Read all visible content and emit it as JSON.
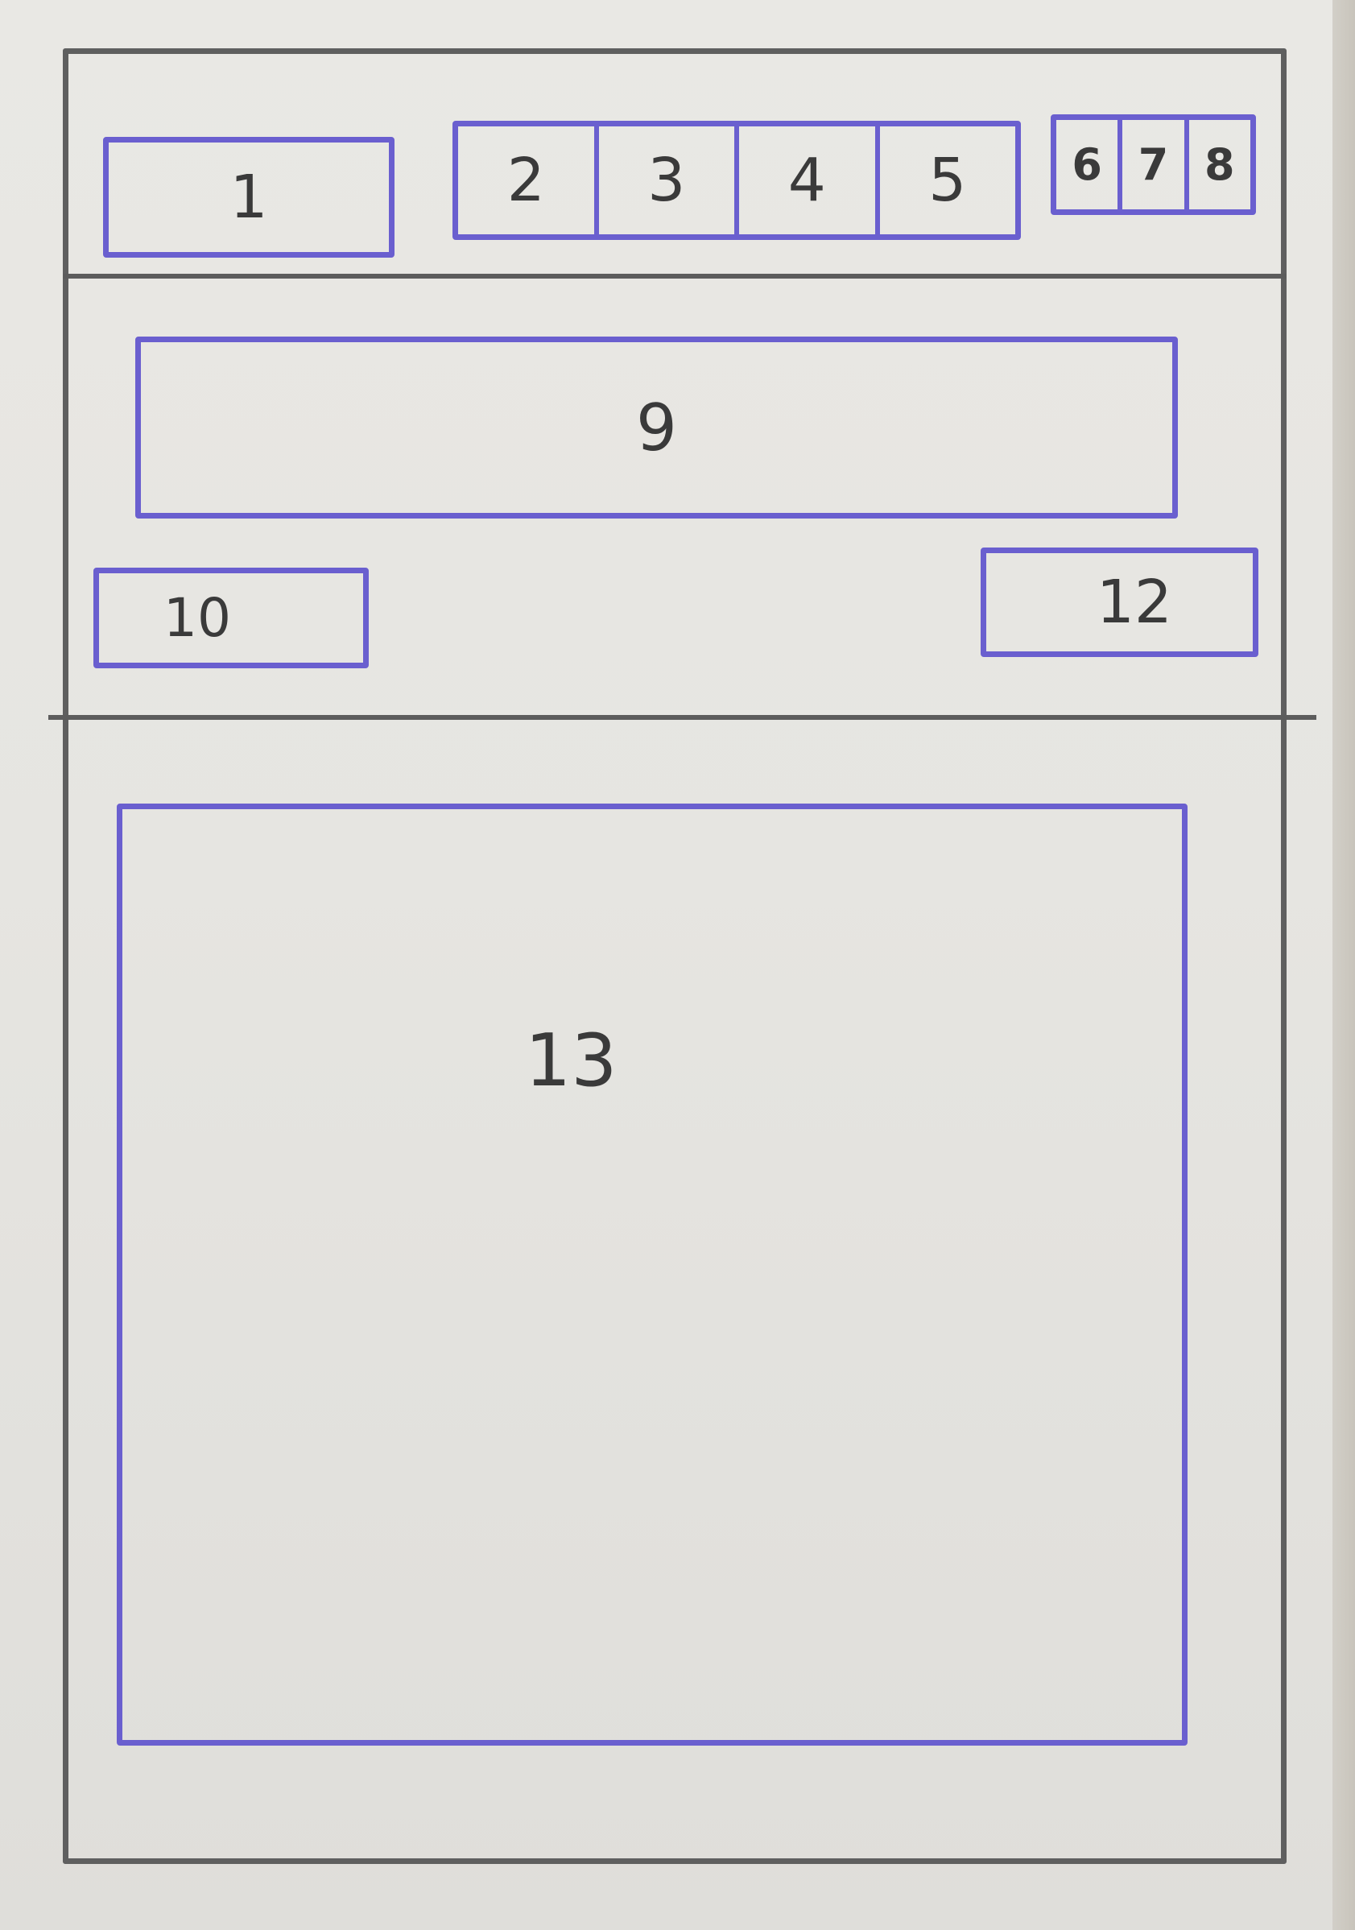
{
  "header": {
    "logo_label": "1",
    "tabs": [
      {
        "label": "2"
      },
      {
        "label": "3"
      },
      {
        "label": "4"
      },
      {
        "label": "5"
      }
    ],
    "mini_buttons": [
      {
        "label": "6"
      },
      {
        "label": "7"
      },
      {
        "label": "8"
      }
    ]
  },
  "controls": {
    "wide_field_label": "9",
    "left_button_label": "10",
    "right_button_label": "12"
  },
  "main": {
    "content_label": "13"
  },
  "colors": {
    "pencil": "#5f5f5f",
    "ink": "#6a5fcf",
    "paper": "#e8e7e3"
  }
}
